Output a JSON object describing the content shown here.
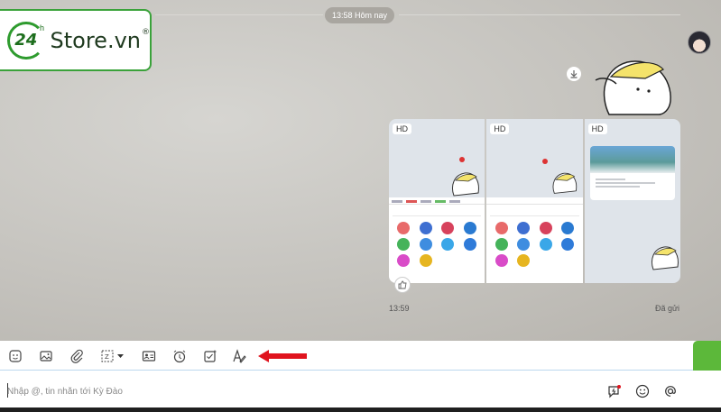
{
  "watermark": {
    "logo_number": "24",
    "logo_superscript": "h",
    "logo_text": "Store.vn",
    "registered_mark": "®"
  },
  "chat": {
    "date_pill": "13:58 Hôm nay",
    "album": {
      "hd_labels": [
        "HD",
        "HD",
        "HD"
      ]
    },
    "message_time": "13:59",
    "message_status": "Đã gửi"
  },
  "composer": {
    "placeholder": "Nhập @, tin nhắn tới Kỳ Đào",
    "toolbar_icons": [
      "sticker-icon",
      "image-icon",
      "attachment-icon",
      "screenshot-icon",
      "contact-card-icon",
      "reminder-icon",
      "task-icon",
      "text-format-icon"
    ],
    "right_icons": [
      "quick-message-icon",
      "emoji-icon",
      "mention-icon"
    ]
  },
  "colors": {
    "annotation_arrow": "#e0141e",
    "logo_green": "#3aa23a",
    "toolbar_border": "#bcd7ee",
    "side_tab": "#5cb83a"
  }
}
